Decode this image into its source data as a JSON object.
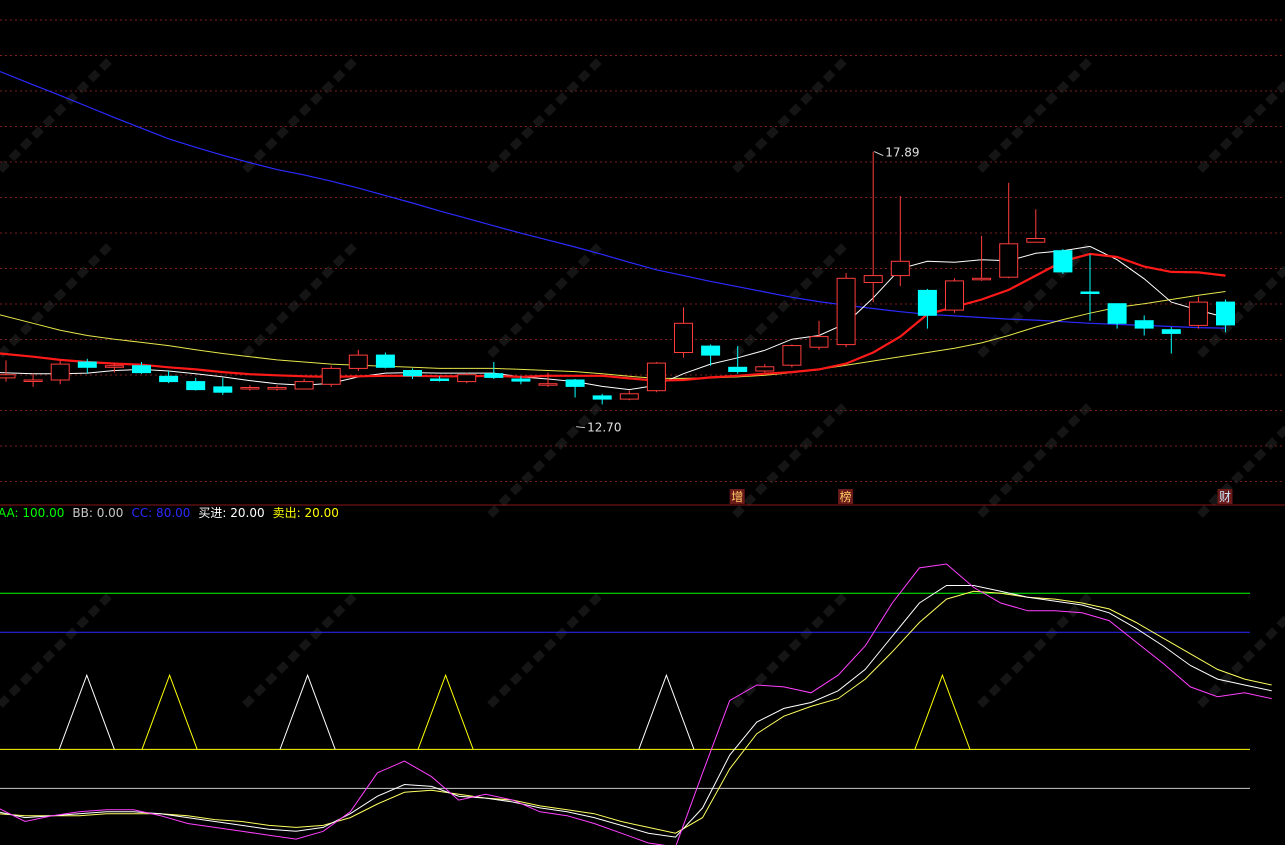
{
  "colors": {
    "background": "#000000",
    "grid": "#7a1e1e",
    "up": "#ff3c3c",
    "down": "#00ffff",
    "ma_fast": "#ffffff",
    "ma_mid": "#ff1a1a",
    "ma_slow": "#e6e64a",
    "ma_long": "#2a2aff",
    "aa_line": "#00ff00",
    "bb_label": "#c8c8c8",
    "cc_line": "#2a2aff",
    "buy_line": "#ffffff",
    "sell_line": "#ffff00",
    "k_line": "#ff40ff",
    "d_line": "#ffffff",
    "j_line": "#ffff60",
    "marker_bg": "#6b1a1a",
    "marker_text": "#ffcc66",
    "marker_text_alt": "#cce4ff"
  },
  "chart_data": [
    {
      "type": "candlestick",
      "price_range": [
        11.6,
        19.9
      ],
      "annotations": {
        "high_label": "17.89",
        "low_label": "12.70"
      },
      "markers": [
        {
          "index": 27,
          "text": "增"
        },
        {
          "index": 31,
          "text": "榜"
        },
        {
          "index": 45,
          "text": "财"
        }
      ],
      "candles": [
        [
          13.62,
          13.68,
          13.95,
          13.55
        ],
        [
          13.56,
          13.58,
          13.7,
          13.45
        ],
        [
          13.58,
          13.88,
          13.95,
          13.5
        ],
        [
          13.92,
          13.82,
          13.98,
          13.7
        ],
        [
          13.82,
          13.85,
          13.9,
          13.72
        ],
        [
          13.85,
          13.72,
          13.92,
          13.7
        ],
        [
          13.65,
          13.55,
          13.75,
          13.52
        ],
        [
          13.55,
          13.4,
          13.62,
          13.38
        ],
        [
          13.45,
          13.35,
          13.62,
          13.3
        ],
        [
          13.42,
          13.44,
          13.48,
          13.38
        ],
        [
          13.41,
          13.44,
          13.48,
          13.38
        ],
        [
          13.41,
          13.55,
          13.6,
          13.4
        ],
        [
          13.5,
          13.8,
          13.85,
          13.45
        ],
        [
          13.8,
          14.05,
          14.15,
          13.75
        ],
        [
          14.05,
          13.82,
          14.1,
          13.8
        ],
        [
          13.76,
          13.66,
          13.8,
          13.6
        ],
        [
          13.6,
          13.58,
          13.65,
          13.55
        ],
        [
          13.55,
          13.68,
          13.72,
          13.52
        ],
        [
          13.7,
          13.63,
          13.92,
          13.6
        ],
        [
          13.6,
          13.56,
          13.65,
          13.5
        ],
        [
          13.5,
          13.51,
          13.72,
          13.45
        ],
        [
          13.58,
          13.46,
          13.6,
          13.25
        ],
        [
          13.28,
          13.22,
          13.32,
          13.12
        ],
        [
          13.22,
          13.32,
          13.38,
          13.2
        ],
        [
          13.38,
          13.9,
          13.92,
          13.35
        ],
        [
          14.1,
          14.65,
          14.95,
          14.0
        ],
        [
          14.22,
          14.05,
          14.25,
          13.85
        ],
        [
          13.82,
          13.74,
          14.22,
          13.7
        ],
        [
          13.75,
          13.83,
          13.88,
          13.72
        ],
        [
          13.86,
          14.23,
          14.25,
          13.82
        ],
        [
          14.2,
          14.4,
          14.7,
          14.15
        ],
        [
          14.25,
          15.5,
          15.6,
          14.2
        ],
        [
          15.42,
          15.55,
          17.89,
          15.05
        ],
        [
          15.55,
          15.82,
          17.05,
          15.35
        ],
        [
          15.27,
          14.8,
          15.3,
          14.55
        ],
        [
          14.9,
          15.45,
          15.5,
          14.85
        ],
        [
          15.48,
          15.5,
          16.3,
          15.45
        ],
        [
          15.52,
          16.15,
          17.3,
          15.5
        ],
        [
          16.18,
          16.25,
          16.8,
          16.2
        ],
        [
          16.02,
          15.62,
          16.05,
          15.58
        ],
        [
          15.24,
          15.22,
          15.95,
          14.7
        ],
        [
          15.02,
          14.65,
          15.02,
          14.55
        ],
        [
          14.7,
          14.56,
          14.8,
          14.42
        ],
        [
          14.53,
          14.46,
          14.58,
          14.08
        ],
        [
          14.61,
          15.05,
          15.15,
          14.55
        ],
        [
          15.05,
          14.62,
          15.1,
          14.48
        ]
      ],
      "ma_fast": [
        13.72,
        13.7,
        13.7,
        13.71,
        13.76,
        13.78,
        13.75,
        13.7,
        13.64,
        13.57,
        13.51,
        13.48,
        13.52,
        13.64,
        13.71,
        13.72,
        13.71,
        13.71,
        13.71,
        13.64,
        13.6,
        13.55,
        13.46,
        13.4,
        13.48,
        13.7,
        13.88,
        14.0,
        14.14,
        14.35,
        14.42,
        14.65,
        15.13,
        15.68,
        15.82,
        15.8,
        15.85,
        15.83,
        15.97,
        16.02,
        16.1,
        15.85,
        15.49,
        15.05,
        14.9,
        14.76
      ],
      "ma_mid": [
        14.08,
        14.02,
        13.96,
        13.92,
        13.89,
        13.87,
        13.82,
        13.78,
        13.73,
        13.69,
        13.67,
        13.65,
        13.64,
        13.65,
        13.66,
        13.66,
        13.65,
        13.65,
        13.66,
        13.64,
        13.66,
        13.66,
        13.66,
        13.61,
        13.57,
        13.58,
        13.63,
        13.66,
        13.7,
        13.73,
        13.78,
        13.89,
        14.1,
        14.4,
        14.82,
        14.96,
        15.1,
        15.28,
        15.55,
        15.82,
        15.96,
        15.9,
        15.72,
        15.62,
        15.61,
        15.55
      ],
      "ma_slow": [
        14.81,
        14.65,
        14.52,
        14.42,
        14.35,
        14.29,
        14.23,
        14.15,
        14.08,
        14.02,
        13.96,
        13.92,
        13.88,
        13.86,
        13.84,
        13.82,
        13.8,
        13.8,
        13.8,
        13.78,
        13.76,
        13.74,
        13.7,
        13.65,
        13.61,
        13.61,
        13.62,
        13.64,
        13.67,
        13.72,
        13.78,
        13.86,
        13.94,
        14.02,
        14.1,
        14.18,
        14.28,
        14.42,
        14.58,
        14.72,
        14.84,
        14.95,
        15.02,
        15.1,
        15.18,
        15.25
      ],
      "ma_long": [
        19.4,
        19.15,
        18.95,
        18.74,
        18.53,
        18.33,
        18.13,
        17.97,
        17.82,
        17.68,
        17.55,
        17.45,
        17.33,
        17.2,
        17.06,
        16.92,
        16.77,
        16.63,
        16.49,
        16.35,
        16.22,
        16.09,
        15.95,
        15.8,
        15.66,
        15.55,
        15.44,
        15.34,
        15.24,
        15.14,
        15.06,
        14.99,
        14.93,
        14.87,
        14.82,
        14.79,
        14.76,
        14.73,
        14.71,
        14.68,
        14.65,
        14.63,
        14.61,
        14.59,
        14.57,
        14.56
      ]
    },
    {
      "type": "line",
      "y_range": [
        -28,
        135
      ],
      "legend": [
        {
          "label": "AA: 100.00",
          "color_key": "aa_line"
        },
        {
          "label": "BB: 0.00",
          "color_key": "bb_label"
        },
        {
          "label": "CC: 80.00",
          "color_key": "cc_line"
        },
        {
          "label": "买进: 20.00",
          "color_key": "buy_line"
        },
        {
          "label": "卖出: 20.00",
          "color_key": "sell_line"
        }
      ],
      "hlines": [
        {
          "value": 100,
          "color_key": "aa_line"
        },
        {
          "value": 80,
          "color_key": "cc_line"
        },
        {
          "value": 20,
          "color_key": "sell_line"
        },
        {
          "value": 0,
          "color_key": "bb_label"
        }
      ],
      "buy_signal_peaks": [
        {
          "start": 2,
          "peak": 3,
          "end": 4,
          "color_key": "buy_line"
        },
        {
          "start": 5,
          "peak": 6,
          "end": 7,
          "color_key": "sell_line"
        },
        {
          "start": 10,
          "peak": 11,
          "end": 12,
          "color_key": "buy_line"
        },
        {
          "start": 15,
          "peak": 16,
          "end": 17,
          "color_key": "sell_line"
        },
        {
          "start": 23,
          "peak": 24,
          "end": 25,
          "color_key": "buy_line"
        },
        {
          "start": 33,
          "peak": 34,
          "end": 35,
          "color_key": "sell_line"
        }
      ],
      "signal_peak_value": 58,
      "k": [
        -10,
        -17,
        -14,
        -12,
        -11,
        -11,
        -14,
        -18,
        -20,
        -22,
        -24,
        -26,
        -22,
        -12,
        8,
        14,
        6,
        -6,
        -3,
        -6,
        -12,
        -14,
        -18,
        -23,
        -28,
        -30,
        8,
        45,
        53,
        52,
        49,
        58,
        73,
        95,
        113,
        115,
        103,
        95,
        91,
        91,
        90,
        86,
        75,
        64,
        52,
        47,
        49,
        46
      ],
      "d": [
        -12,
        -15,
        -14,
        -13,
        -12,
        -12,
        -13,
        -15,
        -17,
        -19,
        -21,
        -22,
        -20,
        -13,
        -4,
        2,
        1,
        -4,
        -5,
        -7,
        -10,
        -12,
        -15,
        -19,
        -23,
        -25,
        -10,
        17,
        34,
        41,
        44,
        50,
        61,
        78,
        95,
        104,
        104,
        101,
        98,
        96,
        94,
        90,
        82,
        73,
        63,
        56,
        53,
        50
      ],
      "j": [
        -13,
        -14,
        -14,
        -14,
        -13,
        -13,
        -13,
        -14,
        -16,
        -17,
        -19,
        -20,
        -19,
        -15,
        -8,
        -2,
        -1,
        -3,
        -5,
        -6,
        -9,
        -11,
        -13,
        -17,
        -20,
        -23,
        -15,
        10,
        28,
        37,
        42,
        46,
        56,
        70,
        85,
        97,
        101,
        100,
        98,
        97,
        95,
        92,
        85,
        77,
        69,
        61,
        56,
        53
      ]
    }
  ]
}
